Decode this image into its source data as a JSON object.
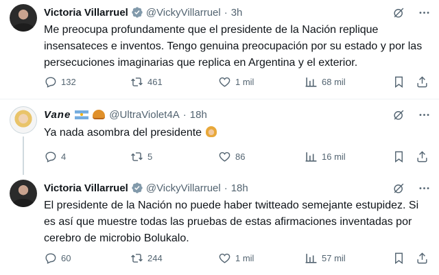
{
  "tweets": [
    {
      "name": "Victoria Villarruel",
      "handle": "@VickyVillarruel",
      "separator": "·",
      "time": "3h",
      "text": "Me preocupa profundamente que el presidente de la Nación replique insensateces e inventos. Tengo genuina preocupación por su estado y por las persecuciones imaginarias que replica en Argentina y el exterior.",
      "replies": "132",
      "reposts": "461",
      "likes": "1 mil",
      "views": "68 mil"
    },
    {
      "name": "Vane",
      "handle": "@UltraViolet4A",
      "separator": "·",
      "time": "18h",
      "text": "Ya nada asombra del presidente",
      "replies": "4",
      "reposts": "5",
      "likes": "86",
      "views": "16 mil"
    },
    {
      "name": "Victoria Villarruel",
      "handle": "@VickyVillarruel",
      "separator": "·",
      "time": "18h",
      "text": "El presidente de la Nación no puede haber twitteado semejante estupidez. Si es así que muestre todas las pruebas de estas afirmaciones inventadas por cerebro de microbio Bolukalo.",
      "replies": "60",
      "reposts": "244",
      "likes": "1 mil",
      "views": "57 mil"
    }
  ],
  "icons": {
    "verified": "verified-badge-icon",
    "grok": "grok-icon",
    "more": "more-icon",
    "reply": "reply-icon",
    "repost": "repost-icon",
    "like": "like-icon",
    "views": "views-icon",
    "bookmark": "bookmark-icon",
    "share": "share-icon"
  },
  "colors": {
    "text": "#0f1419",
    "muted": "#536471",
    "verified": "#829aab",
    "divider": "#eff3f4"
  }
}
